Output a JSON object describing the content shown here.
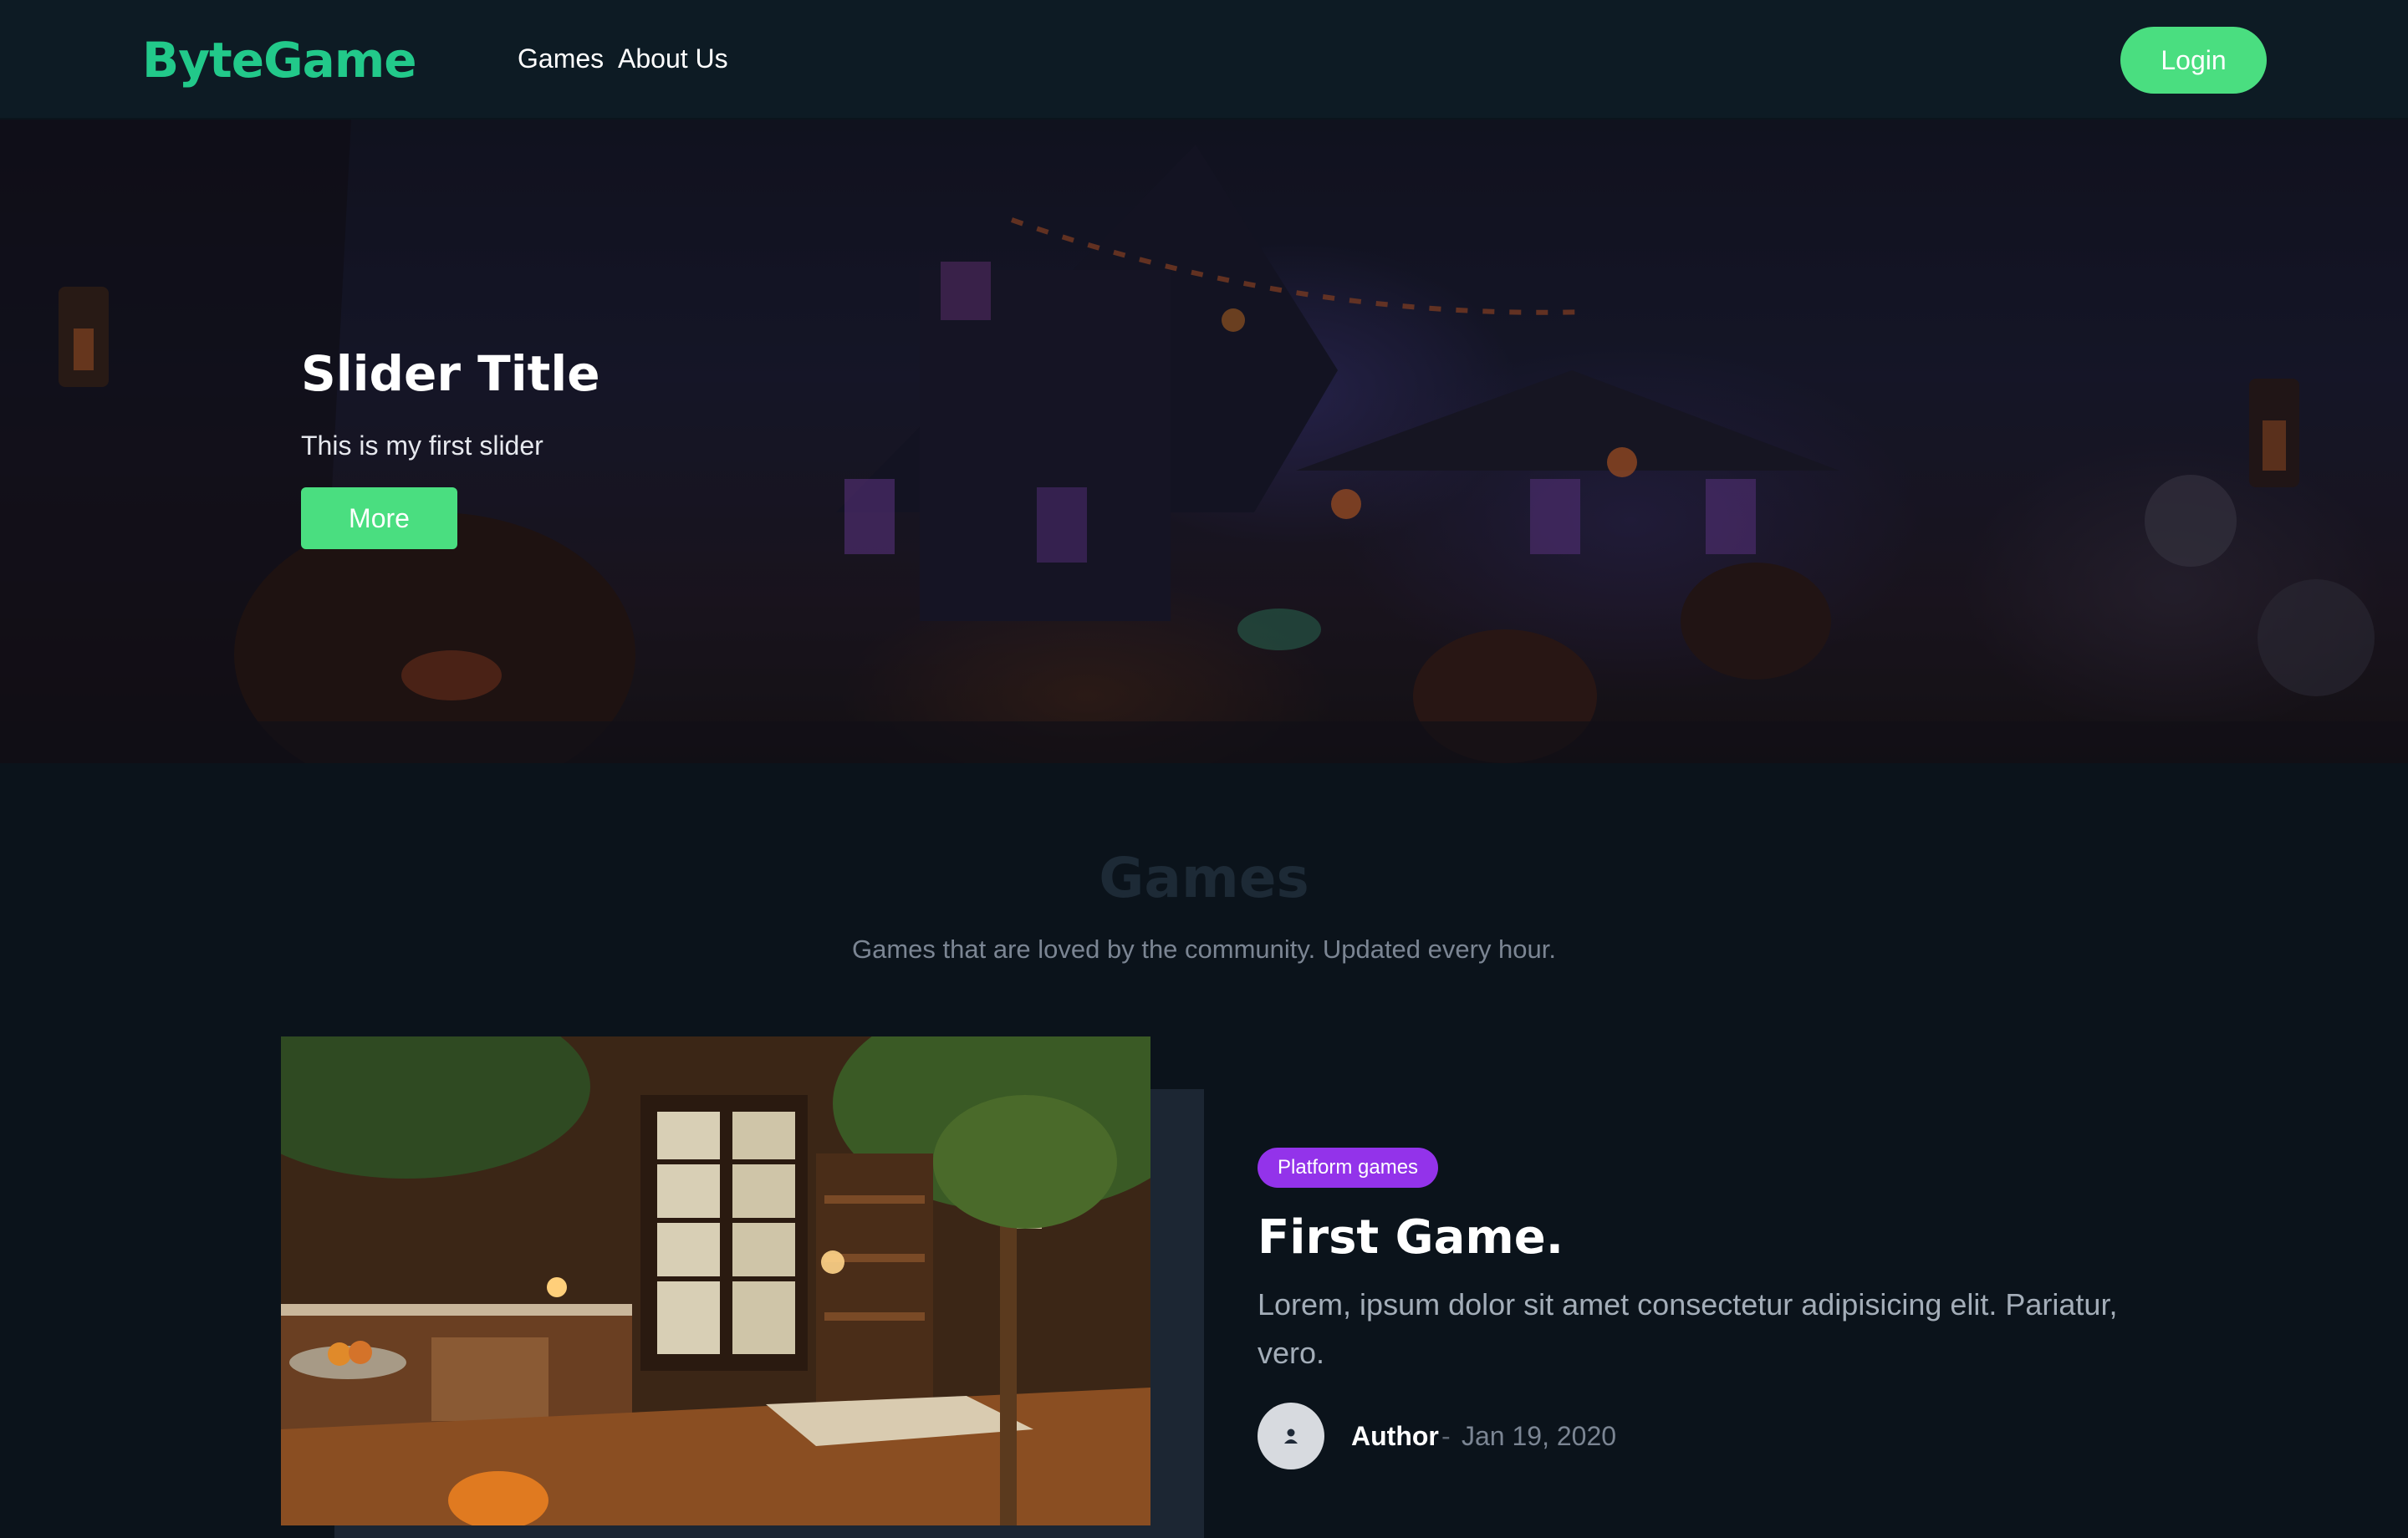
{
  "navbar": {
    "logo": "ByteGame",
    "links": [
      "Games",
      "About Us"
    ],
    "login_label": "Login"
  },
  "hero": {
    "title": "Slider Title",
    "subtitle": "This is my first slider",
    "button_label": "More"
  },
  "games_section": {
    "title": "Games",
    "subtitle": "Games that are loved by the community. Updated every hour."
  },
  "game_card": {
    "tag": "Platform games",
    "title": "First Game.",
    "description": "Lorem, ipsum dolor sit amet consectetur adipisicing elit. Pariatur, vero.",
    "author": "Author",
    "separator": "-",
    "date": "Jan 19, 2020"
  },
  "colors": {
    "brand": "#22c98a",
    "accent_button": "#4ade80",
    "tag": "#9333ea",
    "background": "#0b131b",
    "navbar": "#0d1b24"
  }
}
